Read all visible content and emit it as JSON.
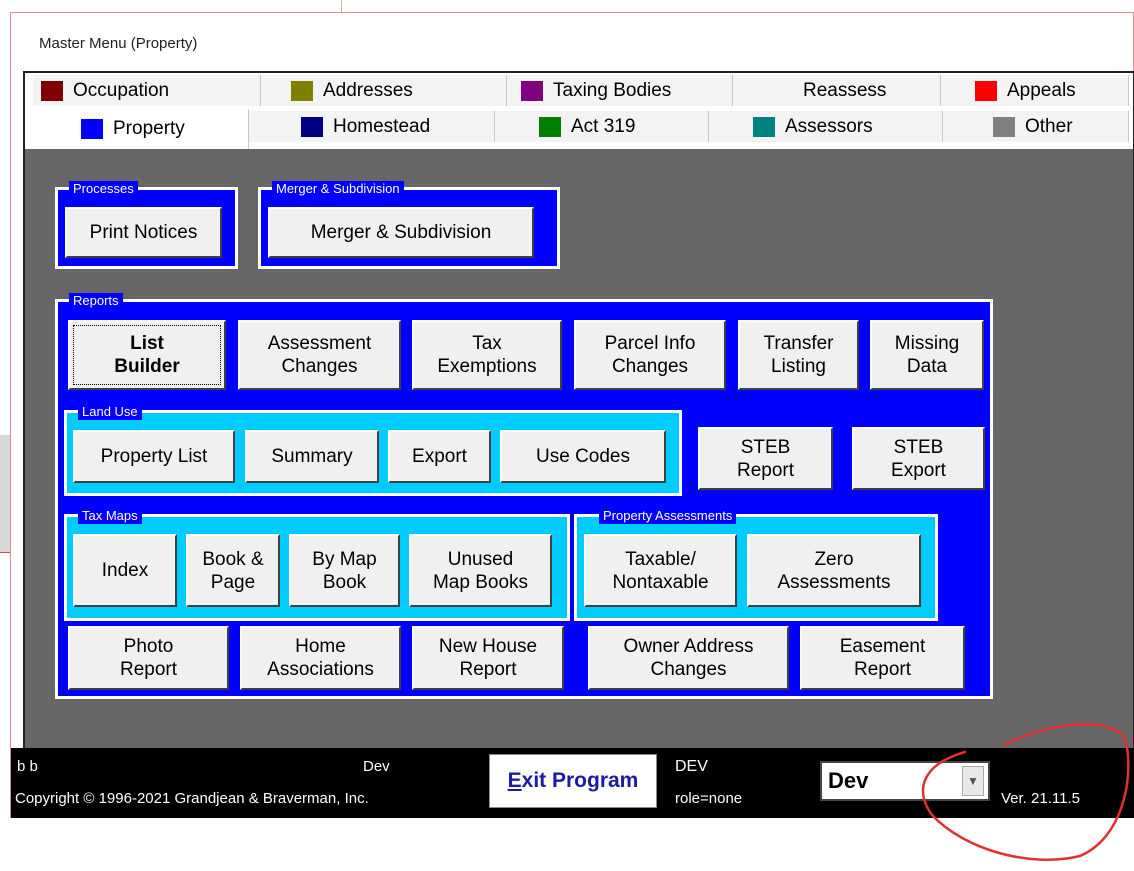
{
  "window_title": "Master Menu (Property)",
  "tabs_row1": [
    {
      "label": "Occupation",
      "color": "#800000"
    },
    {
      "label": "Addresses",
      "color": "#808000"
    },
    {
      "label": "Taxing Bodies",
      "color": "#800080"
    },
    {
      "label": "Reassess",
      "color": ""
    },
    {
      "label": "Appeals",
      "color": "#ff0000"
    }
  ],
  "tabs_row2": [
    {
      "label": "Property",
      "color": "#0000ff",
      "active": true
    },
    {
      "label": "Homestead",
      "color": "#000080"
    },
    {
      "label": "Act 319",
      "color": "#008000"
    },
    {
      "label": "Assessors",
      "color": "#008080"
    },
    {
      "label": "Other",
      "color": "#808080"
    }
  ],
  "groups": {
    "processes": {
      "label": "Processes",
      "print_notices": "Print Notices"
    },
    "merger": {
      "label": "Merger & Subdivision",
      "button": "Merger & Subdivision"
    },
    "reports": {
      "label": "Reports",
      "buttons": [
        "List\nBuilder",
        "Assessment\nChanges",
        "Tax\nExemptions",
        "Parcel Info\nChanges",
        "Transfer\nListing",
        "Missing\nData"
      ],
      "steb_report": "STEB\nReport",
      "steb_export": "STEB\nExport",
      "bottom_buttons": [
        "Photo\nReport",
        "Home\nAssociations",
        "New House\nReport",
        "Owner Address\nChanges",
        "Easement\nReport"
      ]
    },
    "land_use": {
      "label": "Land Use",
      "buttons": [
        "Property List",
        "Summary",
        "Export",
        "Use Codes"
      ]
    },
    "tax_maps": {
      "label": "Tax Maps",
      "buttons": [
        "Index",
        "Book &\nPage",
        "By Map\nBook",
        "Unused\nMap Books"
      ]
    },
    "property_assessments": {
      "label": "Property Assessments",
      "buttons": [
        "Taxable/\nNontaxable",
        "Zero\nAssessments"
      ]
    }
  },
  "status_bar": {
    "user": "b b",
    "env_top": "Dev",
    "copyright": "Copyright © 1996-2021 Grandjean & Braverman, Inc.",
    "exit_accel": "E",
    "exit_rest": "xit Program",
    "db": "DEV",
    "role": "role=none",
    "env_selected": "Dev",
    "version": "Ver. 21.11.5"
  },
  "icons": {
    "dropdown": "chevron-down-icon"
  },
  "colors": {
    "panel_bg": "#666666",
    "group_blue": "#0000ff",
    "group_cyan": "#00ccff",
    "annotation_red": "#e03030"
  }
}
